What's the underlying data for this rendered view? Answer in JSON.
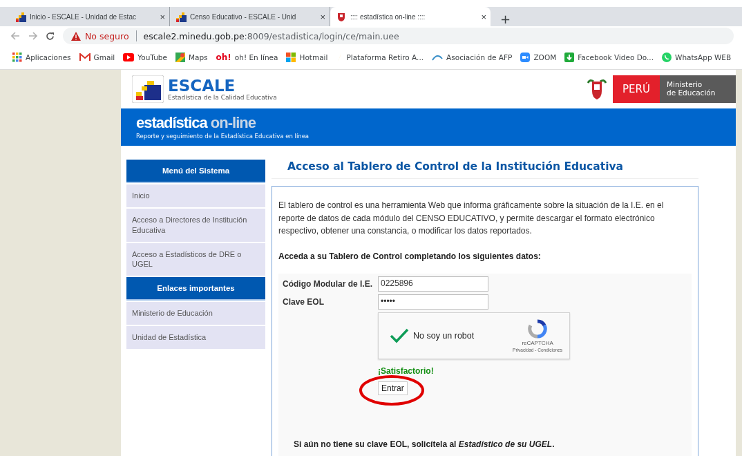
{
  "browser": {
    "tabs": [
      {
        "title": "Inicio - ESCALE - Unidad de Estac",
        "kind": "escale",
        "selected": false
      },
      {
        "title": "Censo Educativo - ESCALE - Unid",
        "kind": "escale",
        "selected": false
      },
      {
        "title": ":::: estadística on-line ::::",
        "kind": "shield",
        "selected": true
      }
    ],
    "new_tab": "+",
    "close": "×",
    "security": "No seguro",
    "url_host": "escale2.minedu.gob.pe",
    "url_path": ":8009/estadistica/login/ce/main.uee",
    "bookmarks": [
      {
        "label": "Aplicaciones",
        "kind": "apps"
      },
      {
        "label": "Gmail",
        "kind": "gmail"
      },
      {
        "label": "YouTube",
        "kind": "youtube"
      },
      {
        "label": "Maps",
        "kind": "maps"
      },
      {
        "label": "oh! En línea",
        "kind": "oh",
        "icon_text": "oh!"
      },
      {
        "label": "Hotmail",
        "kind": "windows"
      },
      {
        "label": "Plataforma Retiro A...",
        "kind": "flash"
      },
      {
        "label": "Asociación de AFP",
        "kind": "arc"
      },
      {
        "label": "ZOOM",
        "kind": "zoom"
      },
      {
        "label": "Facebook Video Do...",
        "kind": "download"
      },
      {
        "label": "WhatsApp WEB",
        "kind": "whatsapp"
      }
    ]
  },
  "header": {
    "logo_title": "ESCALE",
    "logo_subtitle": "Estadística de la Calidad Educativa",
    "country": "PERÚ",
    "ministry_line1": "Ministerio",
    "ministry_line2": "de Educación"
  },
  "banner": {
    "title_main": "estadística",
    "title_accent": "on-line",
    "subtitle": "Reporte y seguimiento de la Estadística Educativa en línea"
  },
  "sidebar": {
    "sections": [
      {
        "heading": "Menú del Sistema",
        "items": [
          "Inicio",
          "Acceso a Directores de Institución Educativa",
          "Acceso a Estadísticos de DRE o UGEL"
        ]
      },
      {
        "heading": "Enlaces importantes",
        "items": [
          "Ministerio de Educación",
          "Unidad de Estadística"
        ]
      }
    ]
  },
  "content": {
    "title": "Acceso al Tablero de Control de la Institución Educativa",
    "intro": "El tablero de control es una herramienta Web que informa gráficamente sobre la situación de la I.E. en el reporte de datos de cada módulo del CENSO EDUCATIVO, y permite descargar el formato electrónico respectivo, obtener una constancia, o modificar los datos reportados.",
    "instruction": "Acceda a su Tablero de Control completando los siguientes datos:",
    "fields": [
      {
        "label": "Código Modular de I.E.",
        "value": "0225896"
      },
      {
        "label": "Clave EOL",
        "value": "•••••"
      }
    ],
    "captcha": {
      "label": "No soy un robot",
      "checked": true,
      "brand": "reCAPTCHA",
      "links": "Privacidad - Condiciones"
    },
    "status": "¡Satisfactorio!",
    "submit": "Entrar",
    "submit_highlighted": true,
    "footer_note": "Si aún no tiene su clave EOL, solicítela al *Estadístico de su UGEL*."
  }
}
